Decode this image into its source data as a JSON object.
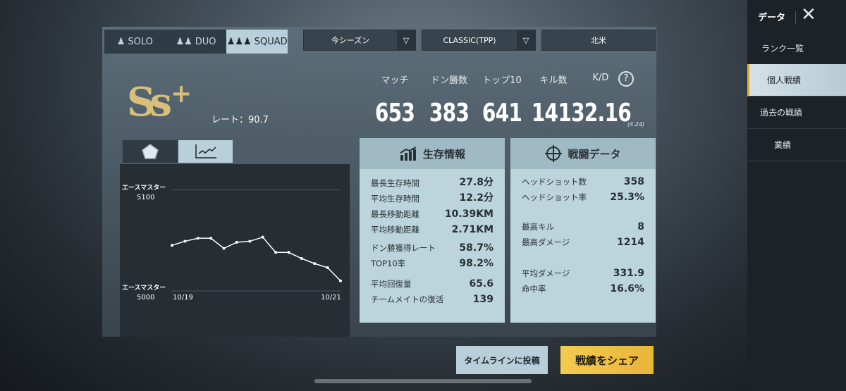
{
  "mode_tabs": [
    {
      "label": "SOLO",
      "icon": "solo-icon"
    },
    {
      "label": "DUO",
      "icon": "duo-icon"
    },
    {
      "label": "SQUAD",
      "icon": "squad-icon",
      "active": true
    }
  ],
  "filters": {
    "season": "今シーズン",
    "mode": "CLASSIC(TPP)",
    "region": "北米"
  },
  "rank": {
    "tier": "Ss",
    "plus": "+",
    "rate_label": "レート：90.7"
  },
  "summary": {
    "labels": [
      "マッチ",
      "ドン勝数",
      "トップ10",
      "キル数",
      "K/D"
    ],
    "values": [
      "653",
      "383",
      "641",
      "1413",
      "2.16"
    ],
    "kd_sub": "(4.24)",
    "help": "?"
  },
  "chart_data": {
    "type": "line",
    "x_tick_labels": [
      "10/19",
      "10/21"
    ],
    "y_tick_labels": [
      {
        "rank": "エースマスター",
        "value": "5100"
      },
      {
        "rank": "エースマスター",
        "value": "5000"
      }
    ],
    "ylim": [
      5000,
      5100
    ],
    "values": [
      5045,
      5049,
      5052,
      5052,
      5042,
      5048,
      5049,
      5053,
      5038,
      5038,
      5032,
      5027,
      5023,
      5010
    ],
    "grid": true,
    "color": "#ffffff"
  },
  "survival": {
    "title": "生存情報",
    "rows": [
      {
        "label": "最長生存時間",
        "value": "27.8分"
      },
      {
        "label": "平均生存時間",
        "value": "12.2分"
      },
      {
        "label": "最長移動距離",
        "value": "10.39KM"
      },
      {
        "label": "平均移動距離",
        "value": "2.71KM"
      },
      {
        "label": "ドン勝獲得レート",
        "value": "58.7%"
      },
      {
        "label": "TOP10率",
        "value": "98.2%"
      },
      {
        "label": "平均回復量",
        "value": "65.6"
      },
      {
        "label": "チームメイトの復活",
        "value": "139"
      }
    ]
  },
  "combat": {
    "title": "戦闘データ",
    "rows": [
      {
        "label": "ヘッドショット数",
        "value": "358"
      },
      {
        "label": "ヘッドショット率",
        "value": "25.3%"
      },
      {
        "label": "最高キル",
        "value": "8"
      },
      {
        "label": "最高ダメージ",
        "value": "1214"
      },
      {
        "label": "平均ダメージ",
        "value": "331.9"
      },
      {
        "label": "命中率",
        "value": "16.6%"
      }
    ]
  },
  "buttons": {
    "timeline": "タイムラインに投稿",
    "share": "戦績をシェア"
  },
  "sidebar": {
    "title": "データ",
    "items": [
      {
        "label": "ランク一覧"
      },
      {
        "label": "個人戦績",
        "active": true
      },
      {
        "label": "過去の戦績"
      },
      {
        "label": "業績"
      }
    ]
  },
  "colors": {
    "accent": "#e8a928",
    "panel": "#bcd4dc",
    "share": "#f1c040"
  }
}
